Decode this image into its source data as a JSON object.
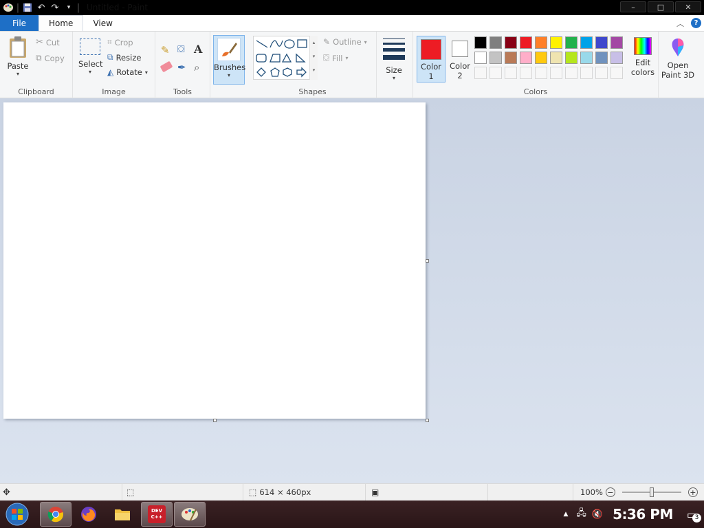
{
  "window": {
    "title": "Untitled - Paint",
    "controls": [
      "–",
      "□",
      "✕"
    ]
  },
  "menu": {
    "file": "File",
    "home": "Home",
    "view": "View"
  },
  "ribbon": {
    "clipboard": {
      "label": "Clipboard",
      "paste": "Paste",
      "cut": "Cut",
      "copy": "Copy"
    },
    "image": {
      "label": "Image",
      "select": "Select",
      "crop": "Crop",
      "resize": "Resize",
      "rotate": "Rotate"
    },
    "tools": {
      "label": "Tools"
    },
    "brushes": {
      "label": "Brushes"
    },
    "shapes": {
      "label": "Shapes",
      "outline": "Outline",
      "fill": "Fill"
    },
    "size": {
      "label": "Size"
    },
    "colors": {
      "label": "Colors",
      "color1_label": "Color",
      "color1_num": "1",
      "color2_label": "Color",
      "color2_num": "2",
      "color1": "#ed1c24",
      "color2": "#ffffff",
      "edit_label": "Edit",
      "edit_label2": "colors",
      "palette_row1": [
        "#000000",
        "#7f7f7f",
        "#880015",
        "#ed1c24",
        "#ff7f27",
        "#fff200",
        "#22b14c",
        "#00a2e8",
        "#3f48cc",
        "#a349a4"
      ],
      "palette_row2": [
        "#ffffff",
        "#c3c3c3",
        "#b97a57",
        "#ffaec9",
        "#ffc90e",
        "#efe4b0",
        "#b5e61d",
        "#99d9ea",
        "#7092be",
        "#c8bfe7"
      ]
    },
    "paint3d": {
      "label1": "Open",
      "label2": "Paint 3D"
    }
  },
  "status": {
    "canvas_size": "614 × 460px",
    "zoom": "100%",
    "zoom_level": 0.5
  },
  "taskbar": {
    "time": "5:36 PM",
    "notif_count": "3",
    "devcpp_top": "DEV",
    "devcpp_bottom": "C++"
  }
}
